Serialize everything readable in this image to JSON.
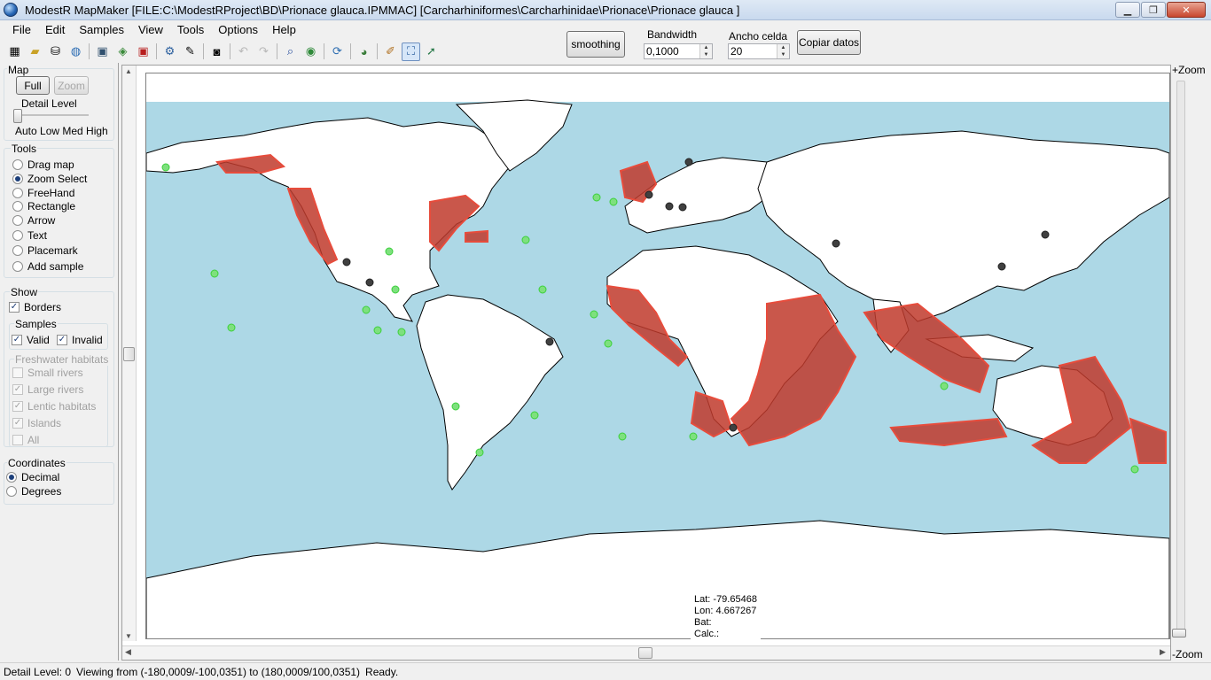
{
  "window": {
    "title": "ModestR MapMaker [FILE:C:\\ModestRProject\\BD\\Prionace glauca.IPMMAC] [Carcharhiniformes\\Carcharhinidae\\Prionace\\Prionace glauca ]",
    "minimize": "▁",
    "maximize": "❐",
    "close": "✕"
  },
  "menu": [
    "File",
    "Edit",
    "Samples",
    "View",
    "Tools",
    "Options",
    "Help"
  ],
  "toolbar": {
    "smoothing_label": "smoothing",
    "bandwidth_label": "Bandwidth",
    "bandwidth_value": "0,1000",
    "cell_label": "Ancho celda",
    "cell_value": "20",
    "copy_label": "Copiar datos"
  },
  "left": {
    "map_group": "Map",
    "full_button": "Full",
    "zoom_button": "Zoom",
    "detail_level_label": "Detail Level",
    "detail_scale": "Auto Low Med High",
    "tools_group": "Tools",
    "tools": [
      {
        "label": "Drag map",
        "checked": false
      },
      {
        "label": "Zoom Select",
        "checked": true
      },
      {
        "label": "FreeHand",
        "checked": false
      },
      {
        "label": "Rectangle",
        "checked": false
      },
      {
        "label": "Arrow",
        "checked": false
      },
      {
        "label": "Text",
        "checked": false
      },
      {
        "label": "Placemark",
        "checked": false
      },
      {
        "label": "Add sample",
        "checked": false
      }
    ],
    "show_group": "Show",
    "borders_label": "Borders",
    "samples_group": "Samples",
    "valid_label": "Valid",
    "invalid_label": "Invalid",
    "freshwater_group": "Freshwater habitats",
    "freshwater": [
      {
        "label": "Small rivers",
        "checked": false
      },
      {
        "label": "Large rivers",
        "checked": true
      },
      {
        "label": "Lentic habitats",
        "checked": true
      },
      {
        "label": "Islands",
        "checked": true
      },
      {
        "label": "All",
        "checked": false
      }
    ],
    "coords_group": "Coordinates",
    "decimal_label": "Decimal",
    "degrees_label": "Degrees"
  },
  "map": {
    "ocean_color": "#add8e6",
    "land_color": "#ffffff",
    "distribution_color": "#c0392b",
    "valid_sample_color": "#3cd03c",
    "invalid_sample_color": "#404040"
  },
  "coords": {
    "lat": "Lat: -79.65468",
    "lon": "Lon: 4.667267",
    "bat": "Bat:",
    "calc": "Calc.:"
  },
  "zoom": {
    "plus": "+Zoom",
    "minus": "-Zoom"
  },
  "status": {
    "detail": "Detail Level: 0",
    "viewing": "Viewing from (-180,0009/-100,0351) to (180,0009/100,0351)",
    "ready": "Ready."
  }
}
